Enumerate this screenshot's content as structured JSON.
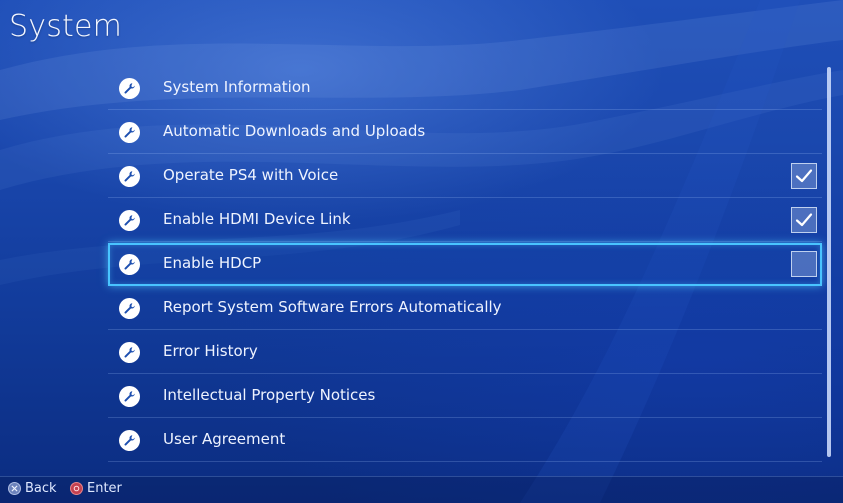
{
  "header": {
    "title": "System"
  },
  "menu": {
    "items": [
      {
        "label": "System Information",
        "icon": "wrench-icon"
      },
      {
        "label": "Automatic Downloads and Uploads",
        "icon": "wrench-icon"
      },
      {
        "label": "Operate PS4 with Voice",
        "icon": "wrench-icon",
        "checkbox": true,
        "checked": true
      },
      {
        "label": "Enable HDMI Device Link",
        "icon": "wrench-icon",
        "checkbox": true,
        "checked": true
      },
      {
        "label": "Enable HDCP",
        "icon": "wrench-icon",
        "checkbox": true,
        "checked": false,
        "selected": true
      },
      {
        "label": "Report System Software Errors Automatically",
        "icon": "wrench-icon"
      },
      {
        "label": "Error History",
        "icon": "wrench-icon"
      },
      {
        "label": "Intellectual Property Notices",
        "icon": "wrench-icon"
      },
      {
        "label": "User Agreement",
        "icon": "wrench-icon"
      }
    ]
  },
  "footer": {
    "back_label": "Back",
    "back_icon": "cross-button-icon",
    "enter_label": "Enter",
    "enter_icon": "circle-button-icon"
  },
  "colors": {
    "background": "#1a47ad",
    "selection_outline": "#49c4ff",
    "text": "#eef3ff",
    "circle_button": "#c4404f"
  }
}
